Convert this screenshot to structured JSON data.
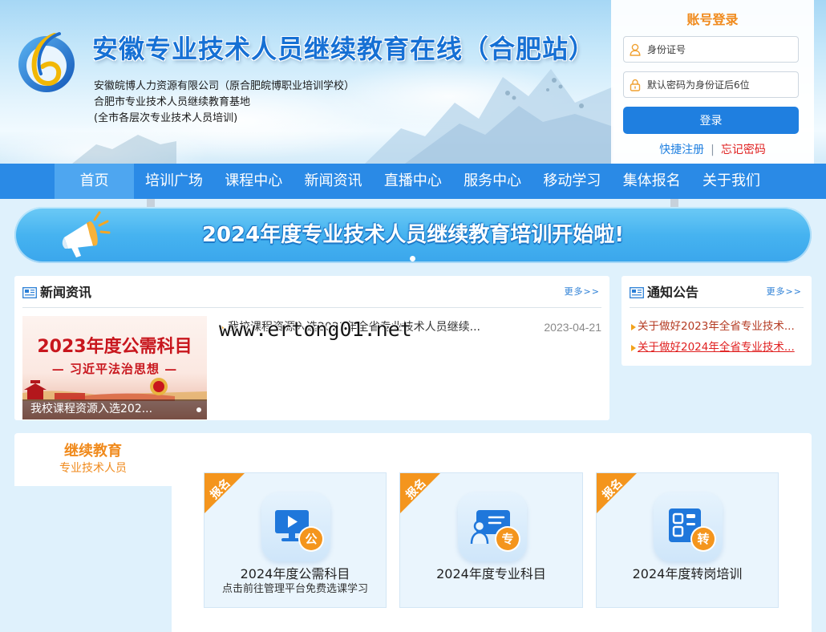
{
  "header": {
    "title": "安徽专业技术人员继续教育在线（合肥站）",
    "org_line_1": "安徽皖博人力资源有限公司（原合肥皖博职业培训学校）",
    "org_line_2": "合肥市专业技术人员继续教育基地",
    "org_line_3": "(全市各层次专业技术人员培训)",
    "logo_icon": "site-logo-icon"
  },
  "login": {
    "title": "账号登录",
    "id_field": {
      "placeholder": "身份证号",
      "value": "",
      "icon": "user-icon"
    },
    "password_field": {
      "placeholder": "默认密码为身份证后6位",
      "value": "",
      "icon": "lock-icon"
    },
    "submit_label": "登录",
    "register_link": "快捷注册",
    "separator": "|",
    "forgot_link": "忘记密码"
  },
  "nav": {
    "active_index": 0,
    "items": [
      "首页",
      "培训广场",
      "课程中心",
      "新闻资讯",
      "直播中心",
      "服务中心",
      "移动学习",
      "集体报名",
      "关于我们"
    ]
  },
  "banner": {
    "text": "2024年度专业技术人员继续教育培训开始啦!",
    "icon": "megaphone-icon"
  },
  "news": {
    "title": "新闻资讯",
    "icon": "news-icon",
    "more_label": "更多>>",
    "slide": {
      "image_title": "2023年度公需科目",
      "image_subtitle": "— 习近平法治思想 —",
      "caption": "我校课程资源入选202..."
    },
    "items": [
      {
        "title": "我校课程资源入选2023年全省专业技术人员继续...",
        "date": "2023-04-21"
      }
    ]
  },
  "notice": {
    "title": "通知公告",
    "icon": "notice-icon",
    "more_label": "更多>>",
    "items": [
      {
        "title": "关于做好2023年全省专业技术...",
        "hovered": false
      },
      {
        "title": "关于做好2024年全省专业技术...",
        "hovered": true
      }
    ]
  },
  "programs": {
    "tab_title": "继续教育",
    "tab_subtitle": "专业技术人员",
    "ribbon_label": "报名",
    "cards": [
      {
        "title": "2024年度公需科目",
        "subtitle": "点击前往管理平台免费选课学习",
        "icon": "monitor-play-icon",
        "badge": "公"
      },
      {
        "title": "2024年度专业科目",
        "subtitle": "",
        "icon": "person-card-icon",
        "badge": "专"
      },
      {
        "title": "2024年度转岗培训",
        "subtitle": "",
        "icon": "document-icon",
        "badge": "转"
      }
    ]
  },
  "watermark": "www.ertong01.net",
  "colors": {
    "page_bg": "#dff1fc",
    "title_blue": "#1670d4",
    "nav_bg": "#2a8ae6",
    "nav_active_bg": "#4ea6f0",
    "accent_orange": "#f08a1c",
    "button_blue": "#1f7fe0",
    "link_blue": "#1f7fe0",
    "link_red": "#e02020",
    "slide_red": "#c8161d"
  }
}
